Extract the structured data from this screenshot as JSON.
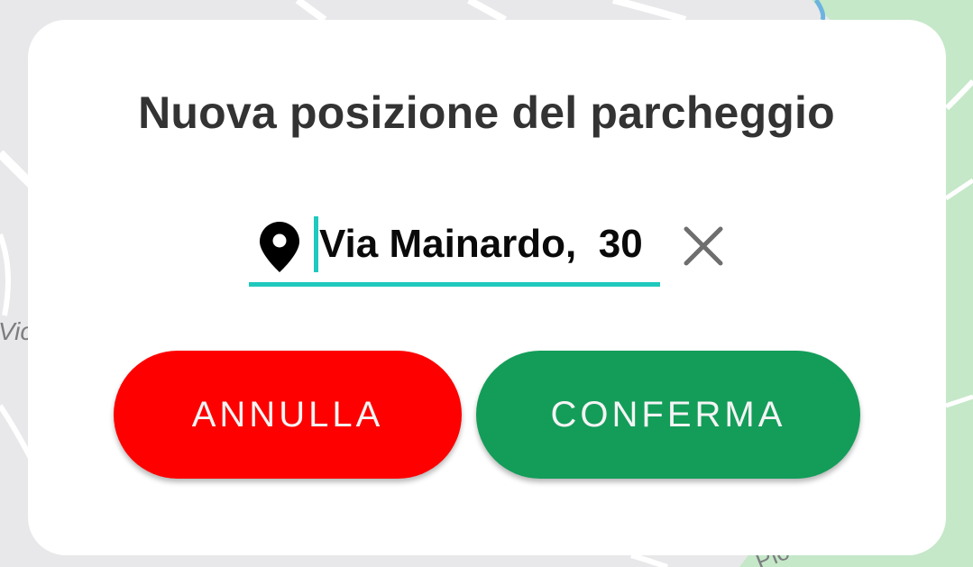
{
  "map": {
    "label_left": "Vic",
    "label_bottom": "Pio",
    "park_color": "#c5e8c8",
    "road_color": "#ffffff",
    "background_color": "#e8e8ea"
  },
  "dialog": {
    "title": "Nuova posizione del parcheggio",
    "address": {
      "icon": "location-pin-icon",
      "value": "Via Mainardo,  30",
      "accent_color": "#1fc9bd"
    },
    "clear_icon": "close-icon",
    "buttons": {
      "cancel_label": "ANNULLA",
      "cancel_color": "#fe0000",
      "confirm_label": "CONFERMA",
      "confirm_color": "#139d59"
    }
  }
}
